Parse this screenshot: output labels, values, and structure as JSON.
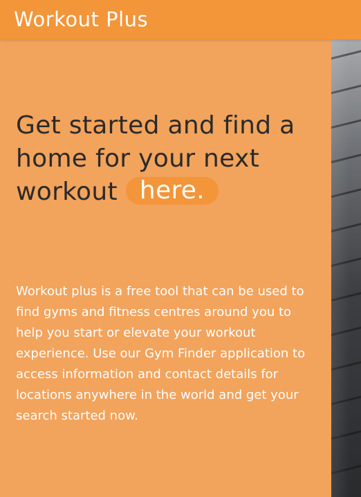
{
  "navbar": {
    "brand": "Workout Plus"
  },
  "hero": {
    "headline": "Get started and find a home for your next workout",
    "cta_link": "here.",
    "description": "Workout plus is a free tool that can be used to find gyms and fitness centres around you to help you start or elevate your workout experience. Use our Gym Finder application to access information and contact details for locations anywhere in the world and get your search started now."
  },
  "colors": {
    "navbar_background": "#f39539",
    "hero_background": "#f2a35c",
    "headline_text": "#2a2a2a",
    "body_text": "#ffffff",
    "cta_pill": "#f39539"
  }
}
